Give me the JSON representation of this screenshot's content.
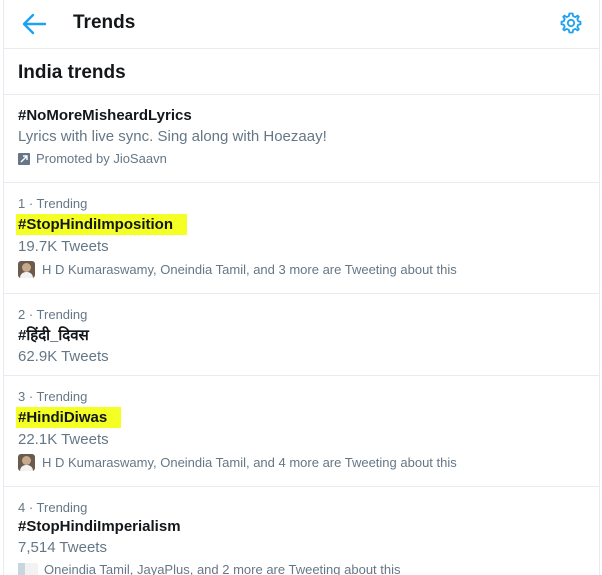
{
  "header": {
    "title": "Trends"
  },
  "section": {
    "title": "India trends"
  },
  "promoted": {
    "hashtag": "#NoMoreMisheardLyrics",
    "description": "Lyrics with live sync. Sing along with Hoezaay!",
    "promoted_by": "Promoted by JioSaavn"
  },
  "trends": [
    {
      "meta": "1 · Trending",
      "hashtag": "#StopHindiImposition",
      "tweets": "19.7K Tweets",
      "people": "H D Kumaraswamy, Oneindia Tamil, and 3 more are Tweeting about this",
      "highlighted": true
    },
    {
      "meta": "2 · Trending",
      "hashtag": "#हिंदी_दिवस",
      "tweets": "62.9K Tweets",
      "people": "",
      "highlighted": false
    },
    {
      "meta": "3 · Trending",
      "hashtag": "#HindiDiwas",
      "tweets": "22.1K Tweets",
      "people": "H D Kumaraswamy, Oneindia Tamil, and 4 more are Tweeting about this",
      "highlighted": true
    },
    {
      "meta": "4 · Trending",
      "hashtag": "#StopHindiImperialism",
      "tweets": "7,514 Tweets",
      "people": "Oneindia Tamil, JayaPlus, and 2 more are Tweeting about this",
      "highlighted": false
    }
  ],
  "colors": {
    "accent": "#1da1f2",
    "highlight": "#f4ff24",
    "muted": "#657786",
    "border": "#e6ecf0"
  },
  "icons": {
    "back": "arrow-left-icon",
    "settings": "gear-icon",
    "promoted": "promoted-icon",
    "avatar": "avatar"
  }
}
